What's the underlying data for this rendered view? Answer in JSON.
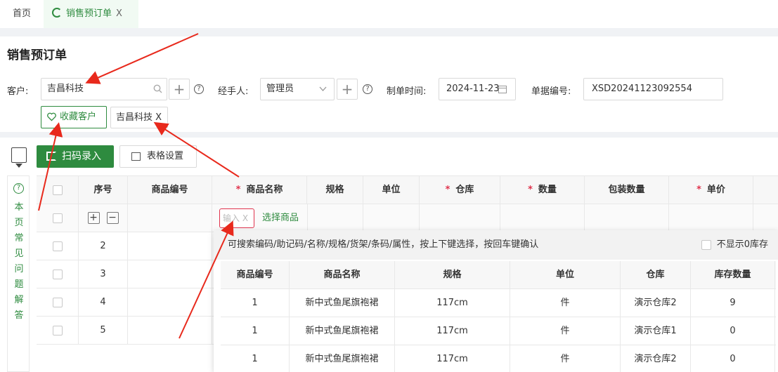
{
  "tabs": {
    "home": "首页",
    "active": "销售预订单",
    "close": "X"
  },
  "page_title": "销售预订单",
  "form": {
    "customer_label": "客户:",
    "customer_value": "吉昌科技",
    "handler_label": "经手人:",
    "handler_value": "管理员",
    "date_label": "制单时间:",
    "date_value": "2024-11-23",
    "docno_label": "单据编号:",
    "docno_value": "XSD20241123092554",
    "help": "?",
    "plus": "+"
  },
  "favorite_customer": "收藏客户",
  "customer_chip": "吉昌科技 X",
  "toolbar": {
    "scan": "扫码录入",
    "grid_settings": "表格设置"
  },
  "faq": {
    "icon": "?",
    "text": "本页常见问题解答"
  },
  "table": {
    "headers": [
      "序号",
      "商品编号",
      "商品名称",
      "规格",
      "单位",
      "仓库",
      "数量",
      "包装数量",
      "单价"
    ],
    "required": [
      "商品名称",
      "仓库",
      "数量",
      "单价"
    ],
    "row_numbers": [
      "2",
      "3",
      "4",
      "5"
    ],
    "input_placeholder": "输入 X",
    "choose_goods": "选择商品",
    "add": "+",
    "remove": "−"
  },
  "dropdown": {
    "hint": "可搜索编码/助记码/名称/规格/货架/条码/属性，按上下键选择，按回车键确认",
    "hide_zero": "不显示0库存",
    "headers": [
      "商品编号",
      "商品名称",
      "规格",
      "单位",
      "仓库",
      "库存数量"
    ],
    "rows": [
      [
        "1",
        "新中式鱼尾旗袍裙",
        "117cm",
        "件",
        "演示仓库2",
        "9"
      ],
      [
        "1",
        "新中式鱼尾旗袍裙",
        "117cm",
        "件",
        "演示仓库1",
        "0"
      ],
      [
        "1",
        "新中式鱼尾旗袍裙",
        "117cm",
        "件",
        "演示仓库2",
        "0"
      ]
    ]
  },
  "colors": {
    "brand": "#2e8b3f",
    "required": "#e0334d",
    "arrow": "#e8291c"
  }
}
